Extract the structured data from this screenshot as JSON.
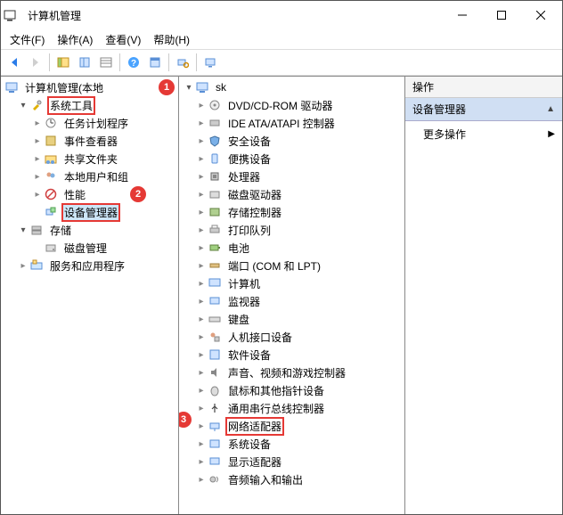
{
  "window": {
    "title": "计算机管理"
  },
  "menus": {
    "file": "文件(F)",
    "action": "操作(A)",
    "view": "查看(V)",
    "help": "帮助(H)"
  },
  "left_tree": {
    "root": "计算机管理(本地",
    "system_tools": "系统工具",
    "task_scheduler": "任务计划程序",
    "event_viewer": "事件查看器",
    "shared_folders": "共享文件夹",
    "local_users": "本地用户和组",
    "performance": "性能",
    "device_manager": "设备管理器",
    "storage": "存储",
    "disk_mgmt": "磁盘管理",
    "services": "服务和应用程序"
  },
  "mid_tree": {
    "root": "sk",
    "dvd": "DVD/CD-ROM 驱动器",
    "ide": "IDE ATA/ATAPI 控制器",
    "security": "安全设备",
    "portable": "便携设备",
    "cpu": "处理器",
    "disk_drives": "磁盘驱动器",
    "storage_ctrl": "存储控制器",
    "print_queue": "打印队列",
    "battery": "电池",
    "ports": "端口 (COM 和 LPT)",
    "computer": "计算机",
    "monitor": "监视器",
    "keyboard": "键盘",
    "hid": "人机接口设备",
    "software_dev": "软件设备",
    "audio_video": "声音、视频和游戏控制器",
    "mouse": "鼠标和其他指针设备",
    "usb_serial": "通用串行总线控制器",
    "network": "网络适配器",
    "system_dev": "系统设备",
    "display": "显示适配器",
    "audio_io": "音频输入和输出"
  },
  "right": {
    "header": "操作",
    "selected": "设备管理器",
    "more": "更多操作"
  },
  "badges": {
    "b1": "1",
    "b2": "2",
    "b3": "3"
  }
}
